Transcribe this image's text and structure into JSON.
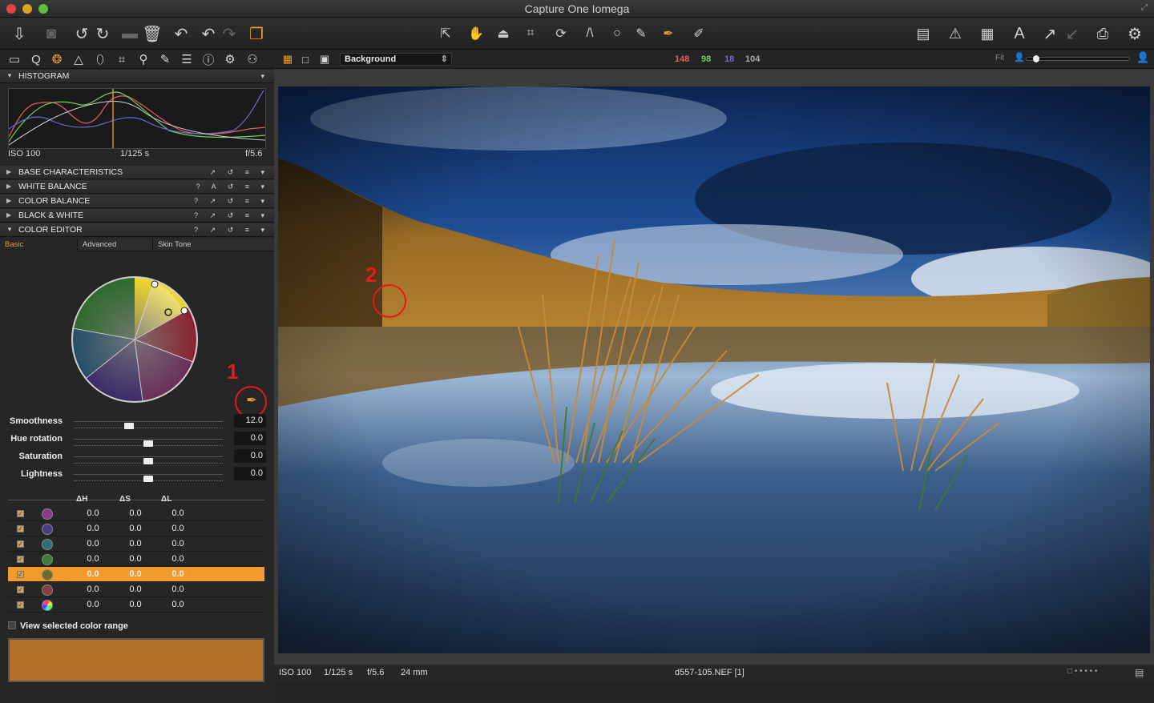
{
  "window": {
    "title": "Capture One Iomega"
  },
  "toolbar": {
    "left_icons": [
      "import-icon",
      "camera-icon",
      "rotate-left-icon",
      "rotate-right-icon",
      "move-icon",
      "trash-icon",
      "undo-icon",
      "redo-left-icon",
      "redo-right-icon",
      "variants-icon"
    ],
    "center_icons": [
      "select-cursor-icon",
      "pan-hand-icon",
      "straighten-icon",
      "crop-icon",
      "rotate-icon",
      "keystone-icon",
      "spot-removal-icon",
      "brush-icon",
      "color-picker-icon",
      "white-balance-picker-icon"
    ],
    "right_icons": [
      "layout-icon",
      "exposure-warning-icon",
      "grid-icon",
      "text-overlay-icon",
      "copy-adjustments-icon",
      "apply-adjustments-icon",
      "print-icon",
      "preferences-icon"
    ]
  },
  "subbar": {
    "tool_tabs": [
      "library-icon",
      "search-icon",
      "color-icon",
      "exposure-icon",
      "lens-icon",
      "crop-icon",
      "focus-icon",
      "details-icon",
      "metadata-icon",
      "info-icon",
      "settings-icon",
      "batch-icon"
    ],
    "background_select": "Background",
    "readout": {
      "r": "148",
      "g": "98",
      "b": "18",
      "l": "104"
    },
    "fit_label": "Fit"
  },
  "panel": {
    "histogram": {
      "title": "HISTOGRAM",
      "iso": "ISO 100",
      "shutter": "1/125 s",
      "aperture": "f/5.6"
    },
    "sections": [
      {
        "label": "BASE CHARACTERISTICS",
        "controls": "↗ ↺ ≡ ▾"
      },
      {
        "label": "WHITE BALANCE",
        "controls": "? A ↺ ≡ ▾"
      },
      {
        "label": "COLOR BALANCE",
        "controls": "? ↗ ↺ ≡ ▾"
      },
      {
        "label": "BLACK & WHITE",
        "controls": "? ↗ ↺ ≡ ▾"
      },
      {
        "label": "COLOR EDITOR",
        "controls": "? ↗ ↺ ≡ ▾"
      }
    ],
    "tabs": [
      "Basic",
      "Advanced",
      "Skin Tone"
    ],
    "sliders": [
      {
        "label": "Smoothness",
        "value": "12.0",
        "level": 0.37
      },
      {
        "label": "Hue rotation",
        "value": "0.0",
        "level": 0.5
      },
      {
        "label": "Saturation",
        "value": "0.0",
        "level": 0.5
      },
      {
        "label": "Lightness",
        "value": "0.0",
        "level": 0.5
      }
    ],
    "table_headers": {
      "dh": "ΔH",
      "ds": "ΔS",
      "dl": "ΔL"
    },
    "rows": [
      {
        "color": "#8a3a86",
        "dh": "0.0",
        "ds": "0.0",
        "dl": "0.0",
        "checked": true,
        "selected": false
      },
      {
        "color": "#4a3e86",
        "dh": "0.0",
        "ds": "0.0",
        "dl": "0.0",
        "checked": true,
        "selected": false
      },
      {
        "color": "#2f6f7a",
        "dh": "0.0",
        "ds": "0.0",
        "dl": "0.0",
        "checked": true,
        "selected": false
      },
      {
        "color": "#3f7d3a",
        "dh": "0.0",
        "ds": "0.0",
        "dl": "0.0",
        "checked": true,
        "selected": false
      },
      {
        "color": "#6f6a26",
        "dh": "0.0",
        "ds": "0.0",
        "dl": "0.0",
        "checked": true,
        "selected": true
      },
      {
        "color": "#8a3a3a",
        "dh": "0.0",
        "ds": "0.0",
        "dl": "0.0",
        "checked": true,
        "selected": false
      },
      {
        "color": "rainbow",
        "dh": "0.0",
        "ds": "0.0",
        "dl": "0.0",
        "checked": true,
        "selected": false
      }
    ],
    "view_selected_label": "View selected color range",
    "swatch_color": "#b07226"
  },
  "annotations": {
    "one": "1",
    "two": "2"
  },
  "status": {
    "iso": "ISO 100",
    "shutter": "1/125 s",
    "aperture": "f/5.6",
    "focal": "24 mm",
    "filename": "d557-105.NEF [1]"
  },
  "colors": {
    "accent": "#f29b2c",
    "annotation": "#e21a1a",
    "r": "#e45d5d",
    "g": "#6fcf5a",
    "b": "#6a6ad8",
    "l": "#aaaaaa"
  }
}
